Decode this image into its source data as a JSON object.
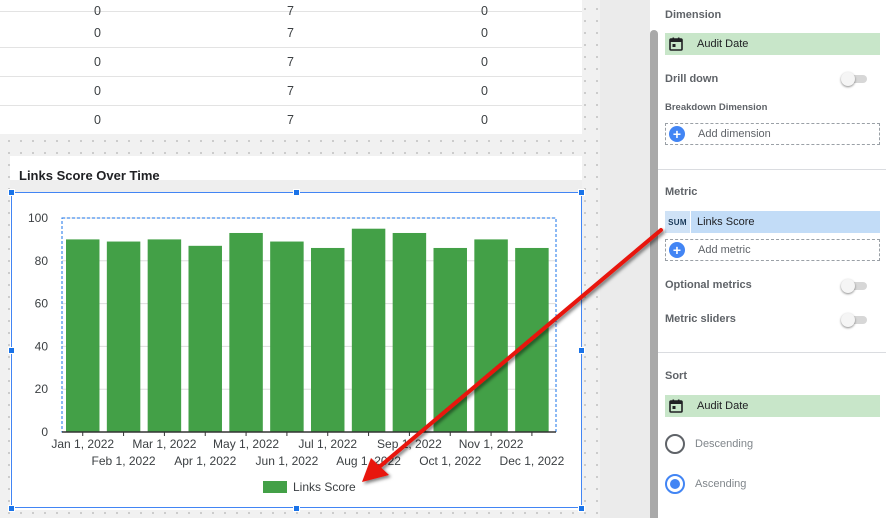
{
  "table": {
    "rows": [
      {
        "a": "0",
        "b": "7",
        "c": "0"
      },
      {
        "a": "0",
        "b": "7",
        "c": "0"
      },
      {
        "a": "0",
        "b": "7",
        "c": "0"
      },
      {
        "a": "0",
        "b": "7",
        "c": "0"
      },
      {
        "a": "0",
        "b": "7",
        "c": "0"
      }
    ]
  },
  "chart": {
    "title": "Links Score Over Time",
    "legend_label": "Links Score",
    "bar_color": "#43a047"
  },
  "chart_data": {
    "type": "bar",
    "title": "Links Score Over Time",
    "categories": [
      "Jan 1, 2022",
      "Feb 1, 2022",
      "Mar 1, 2022",
      "Apr 1, 2022",
      "May 1, 2022",
      "Jun 1, 2022",
      "Jul 1, 2022",
      "Aug 1, 2022",
      "Sep 1, 2022",
      "Oct 1, 2022",
      "Nov 1, 2022",
      "Dec 1, 2022"
    ],
    "series": [
      {
        "name": "Links Score",
        "values": [
          90,
          89,
          90,
          87,
          93,
          89,
          86,
          95,
          93,
          86,
          90,
          86
        ]
      }
    ],
    "ylim": [
      0,
      100
    ],
    "yticks": [
      0,
      20,
      40,
      60,
      80,
      100
    ],
    "grid": true,
    "legend": "bottom"
  },
  "panel": {
    "dimension_title": "Dimension",
    "dimension_chip": "Audit Date",
    "drill_down_label": "Drill down",
    "breakdown_label": "Breakdown Dimension",
    "add_dimension": "Add dimension",
    "metric_title": "Metric",
    "metric_agg": "SUM",
    "metric_chip": "Links Score",
    "add_metric": "Add metric",
    "optional_metrics": "Optional metrics",
    "metric_sliders": "Metric sliders",
    "sort_title": "Sort",
    "sort_chip": "Audit Date",
    "descending": "Descending",
    "ascending": "Ascending",
    "colors": {
      "dimension_chip": "#c8e6c9",
      "metric_chip": "#c2dcf7",
      "accent": "#4285f4"
    }
  },
  "annotation": {
    "arrow_color": "#e8120c"
  }
}
